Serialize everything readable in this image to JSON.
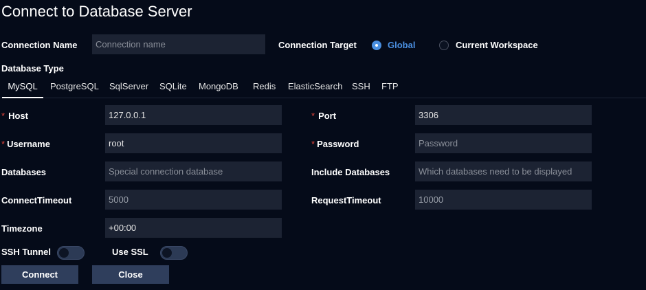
{
  "dialog": {
    "title": "Connect to Database Server"
  },
  "connection": {
    "name_label": "Connection Name",
    "name_placeholder": "Connection name",
    "target_label": "Connection Target",
    "target_options": [
      "Global",
      "Current Workspace"
    ],
    "target_selected": "Global"
  },
  "db_type": {
    "label": "Database Type",
    "tabs": [
      "MySQL",
      "PostgreSQL",
      "SqlServer",
      "SQLite",
      "MongoDB",
      "Redis",
      "ElasticSearch",
      "SSH",
      "FTP"
    ],
    "active": "MySQL"
  },
  "form": {
    "host": {
      "required_mark": "*",
      "label": "Host",
      "value": "127.0.0.1"
    },
    "port": {
      "required_mark": "*",
      "label": "Port",
      "value": "3306"
    },
    "username": {
      "required_mark": "*",
      "label": "Username",
      "value": "root"
    },
    "password": {
      "required_mark": "*",
      "label": "Password",
      "placeholder": "Password"
    },
    "databases": {
      "label": "Databases",
      "placeholder": "Special connection database"
    },
    "include_databases": {
      "label": "Include Databases",
      "placeholder": "Which databases need to be displayed"
    },
    "connect_timeout": {
      "label": "ConnectTimeout",
      "value": "5000"
    },
    "request_timeout": {
      "label": "RequestTimeout",
      "value": "10000"
    },
    "timezone": {
      "label": "Timezone",
      "value": "+00:00"
    }
  },
  "toggles": {
    "ssh_tunnel": {
      "label": "SSH Tunnel",
      "on": false
    },
    "use_ssl": {
      "label": "Use SSL",
      "on": false
    }
  },
  "actions": {
    "connect_label": "Connect",
    "close_label": "Close"
  },
  "colors": {
    "background": "#050b19",
    "input_bg": "#1c2333",
    "accent": "#4a8fe0",
    "required": "#e0453a",
    "button_bg": "#2f3e5c"
  }
}
